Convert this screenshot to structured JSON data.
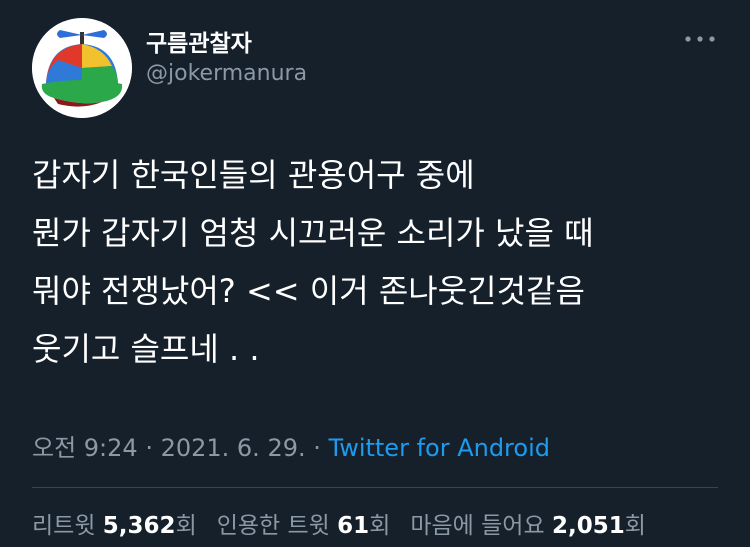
{
  "user": {
    "display_name": "구름관찰자",
    "handle": "@jokermanura",
    "avatar_icon": "propeller-cap-icon"
  },
  "tweet": {
    "lines": [
      "갑자기 한국인들의 관용어구 중에",
      "뭔가 갑자기 엄청 시끄러운 소리가 났을 때",
      "뭐야 전쟁났어? << 이거 존나웃긴것같음",
      "웃기고 슬프네 . ."
    ]
  },
  "meta": {
    "time": "오전 9:24",
    "separator1": " · ",
    "date": "2021. 6. 29.",
    "separator2": " · ",
    "source": "Twitter for Android"
  },
  "stats": {
    "retweets_label": "리트윗",
    "retweets_count": "5,362",
    "retweets_unit": "회",
    "quotes_label": "인용한 트윗",
    "quotes_count": "61",
    "quotes_unit": "회",
    "likes_label": "마음에 들어요",
    "likes_count": "2,051",
    "likes_unit": "회"
  },
  "colors": {
    "background": "#15202b",
    "text": "#ffffff",
    "muted": "#8b98a5",
    "accent": "#1d9bf0",
    "divider": "#38444d"
  }
}
